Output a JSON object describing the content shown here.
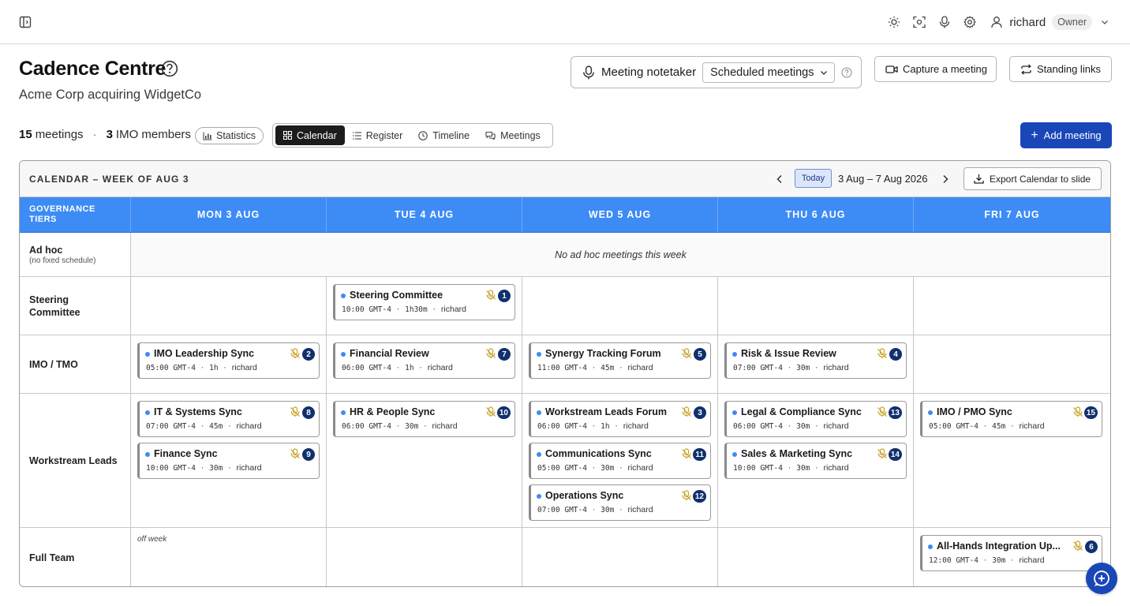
{
  "topbar": {
    "user_name": "richard",
    "role": "Owner",
    "icons": [
      "sidebar-toggle-icon",
      "sun-icon",
      "focus-icon",
      "microphone-icon",
      "gear-icon",
      "user-icon",
      "chevron-down-icon"
    ]
  },
  "header": {
    "title": "Cadence Centre",
    "subtitle": "Acme Corp acquiring WidgetCo",
    "notetaker_label": "Meeting notetaker",
    "notetaker_value": "Scheduled meetings",
    "capture_label": "Capture a meeting",
    "standing_label": "Standing links"
  },
  "summary": {
    "meetings_count": "15",
    "meetings_word": "meetings",
    "members_count": "3",
    "members_word": "IMO members",
    "statistics_label": "Statistics"
  },
  "views": [
    {
      "label": "Calendar",
      "active": true
    },
    {
      "label": "Register",
      "active": false
    },
    {
      "label": "Timeline",
      "active": false
    },
    {
      "label": "Meetings",
      "active": false
    }
  ],
  "add_meeting_label": "Add meeting",
  "calendar": {
    "title": "CALENDAR – WEEK OF AUG 3",
    "today_label": "Today",
    "date_range": "3 Aug – 7 Aug 2026",
    "export_label": "Export Calendar to slide",
    "tier_header": "GOVERNANCE TIERS",
    "days": [
      "MON 3 AUG",
      "TUE 4 AUG",
      "WED 5 AUG",
      "THU 6 AUG",
      "FRI 7 AUG"
    ],
    "rows": {
      "adhoc": {
        "label": "Ad hoc",
        "sub": "(no fixed schedule)",
        "empty": "No ad hoc meetings this week"
      },
      "steering": {
        "label": "Steering Committee"
      },
      "imo": {
        "label": "IMO / TMO"
      },
      "workstream": {
        "label": "Workstream Leads"
      },
      "fullteam": {
        "label": "Full Team",
        "off_week": "off week"
      }
    },
    "meetings": {
      "m1": {
        "name": "Steering Committee",
        "time": "10:00",
        "tz": "GMT-4",
        "duration": "1h30m",
        "owner": "richard",
        "num": "1"
      },
      "m2": {
        "name": "IMO Leadership Sync",
        "time": "05:00",
        "tz": "GMT-4",
        "duration": "1h",
        "owner": "richard",
        "num": "2"
      },
      "m7": {
        "name": "Financial Review",
        "time": "06:00",
        "tz": "GMT-4",
        "duration": "1h",
        "owner": "richard",
        "num": "7"
      },
      "m5": {
        "name": "Synergy Tracking Forum",
        "time": "11:00",
        "tz": "GMT-4",
        "duration": "45m",
        "owner": "richard",
        "num": "5"
      },
      "m4": {
        "name": "Risk & Issue Review",
        "time": "07:00",
        "tz": "GMT-4",
        "duration": "30m",
        "owner": "richard",
        "num": "4"
      },
      "m8": {
        "name": "IT & Systems Sync",
        "time": "07:00",
        "tz": "GMT-4",
        "duration": "45m",
        "owner": "richard",
        "num": "8"
      },
      "m9": {
        "name": "Finance Sync",
        "time": "10:00",
        "tz": "GMT-4",
        "duration": "30m",
        "owner": "richard",
        "num": "9"
      },
      "m10": {
        "name": "HR & People Sync",
        "time": "06:00",
        "tz": "GMT-4",
        "duration": "30m",
        "owner": "richard",
        "num": "10"
      },
      "m3": {
        "name": "Workstream Leads Forum",
        "time": "06:00",
        "tz": "GMT-4",
        "duration": "1h",
        "owner": "richard",
        "num": "3"
      },
      "m11": {
        "name": "Communications Sync",
        "time": "05:00",
        "tz": "GMT-4",
        "duration": "30m",
        "owner": "richard",
        "num": "11"
      },
      "m12": {
        "name": "Operations Sync",
        "time": "07:00",
        "tz": "GMT-4",
        "duration": "30m",
        "owner": "richard",
        "num": "12"
      },
      "m13": {
        "name": "Legal & Compliance Sync",
        "time": "06:00",
        "tz": "GMT-4",
        "duration": "30m",
        "owner": "richard",
        "num": "13"
      },
      "m14": {
        "name": "Sales & Marketing Sync",
        "time": "10:00",
        "tz": "GMT-4",
        "duration": "30m",
        "owner": "richard",
        "num": "14"
      },
      "m15": {
        "name": "IMO / PMO Sync",
        "time": "05:00",
        "tz": "GMT-4",
        "duration": "45m",
        "owner": "richard",
        "num": "15"
      },
      "m6": {
        "name": "All-Hands Integration Up...",
        "time": "12:00",
        "tz": "GMT-4",
        "duration": "30m",
        "owner": "richard",
        "num": "6"
      }
    }
  },
  "colors": {
    "accent": "#1a47b8",
    "grid_header": "#3d8bf5",
    "badge": "#10306e",
    "mic_off": "#c9a227"
  }
}
